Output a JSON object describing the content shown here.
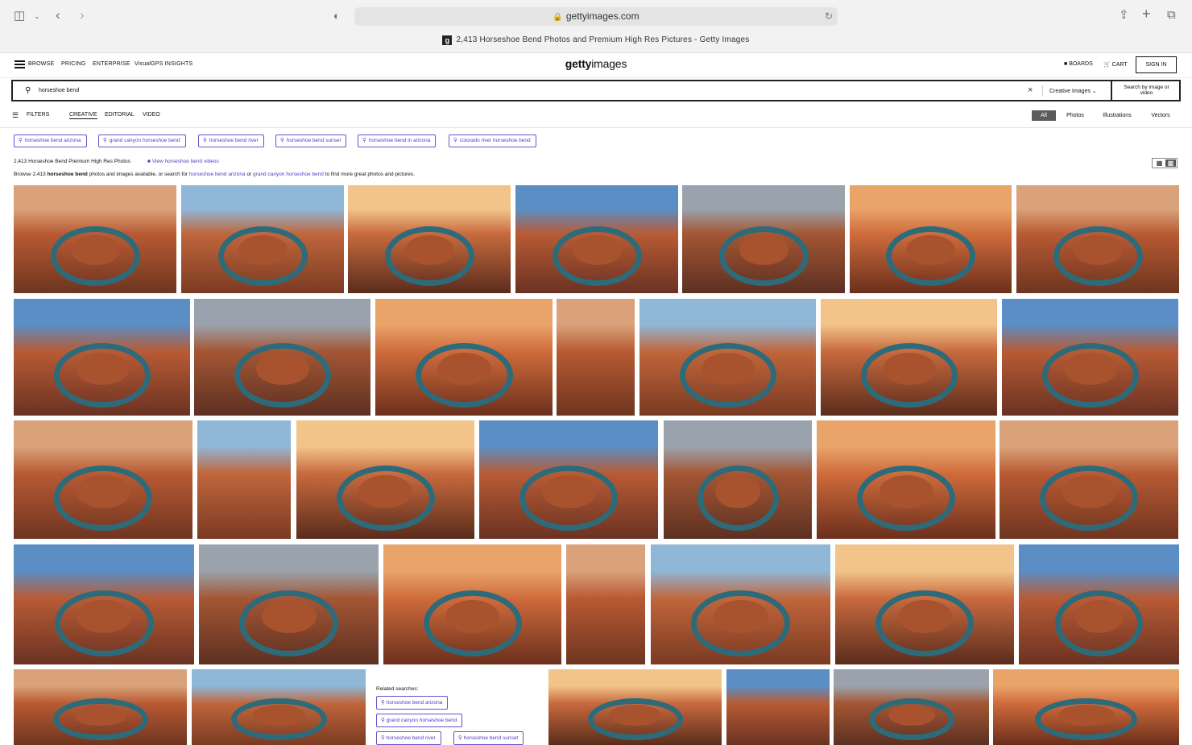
{
  "browser": {
    "url": "gettyimages.com",
    "tab_title": "2,413 Horseshoe Bend Photos and Premium High Res Pictures - Getty Images",
    "favicon_letter": "g"
  },
  "header": {
    "nav": [
      "BROWSE",
      "PRICING",
      "ENTERPRISE",
      "VisualGPS INSIGHTS"
    ],
    "logo_bold": "getty",
    "logo_rest": "images",
    "boards": "BOARDS",
    "cart": "CART",
    "sign_in": "SIGN IN"
  },
  "search": {
    "query": "horseshoe bend",
    "type": "Creative Images",
    "visual_search_line1": "Search by image or",
    "visual_search_line2": "video"
  },
  "filters": {
    "label": "FILTERS",
    "tabs": [
      "CREATIVE",
      "EDITORIAL",
      "VIDEO"
    ],
    "segments": [
      "All",
      "Photos",
      "Illustrations",
      "Vectors"
    ]
  },
  "chips": [
    "horseshoe bend arizona",
    "grand canyon horseshoe bend",
    "horseshoe bend river",
    "horseshoe bend sunset",
    "horseshoe bend in arizona",
    "colorado river horseshoe bend"
  ],
  "results": {
    "count_text": "2,413 Horseshoe Bend Premium High Res Photos",
    "video_link": "View horseshoe bend videos",
    "browse_pre": "Browse 2,413 ",
    "browse_bold": "horseshoe bend",
    "browse_mid": " photos and images available, or search for ",
    "browse_link1": "horseshoe bend arizona",
    "browse_or": " or ",
    "browse_link2": "grand canyon horseshoe bend",
    "browse_post": " to find more great photos and pictures."
  },
  "related": {
    "label": "Related searches:",
    "items": [
      "horseshoe bend arizona",
      "grand canyon horseshoe bend",
      "horseshoe bend river",
      "horseshoe bend sunset"
    ]
  }
}
